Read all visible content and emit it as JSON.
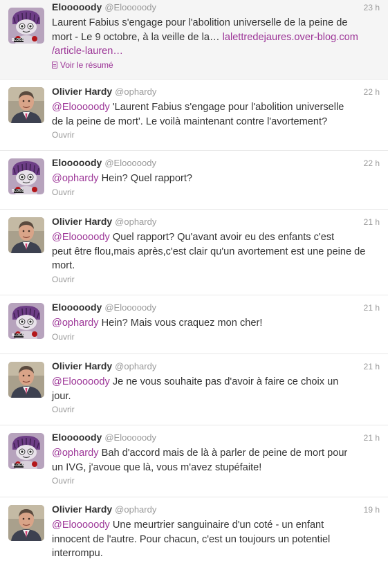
{
  "tweets": [
    {
      "name": "Elooooody",
      "handle": "@Elooooody",
      "time": "23 h",
      "avatar": "eloody",
      "line1": "Laurent Fabius s'engage pour l'abolition universelle de la peine de",
      "line2a": "mort - Le 9 octobre, à la veille de la… ",
      "link_a": "lalettredejaures.over-blog.com",
      "link_b": "/article-lauren…",
      "action": "Voir le résumé"
    },
    {
      "name": "Olivier Hardy",
      "handle": "@ophardy",
      "time": "22 h",
      "avatar": "hardy",
      "mention": "@Elooooody",
      "text_l1": " 'Laurent Fabius s'engage pour l'abolition universelle",
      "text_l2": "de la peine de mort'. Le voilà maintenant contre l'avortement?",
      "action": "Ouvrir"
    },
    {
      "name": "Elooooody",
      "handle": "@Elooooody",
      "time": "22 h",
      "avatar": "eloody",
      "mention": "@ophardy",
      "text_l1": " Hein? Quel rapport?",
      "action": "Ouvrir"
    },
    {
      "name": "Olivier Hardy",
      "handle": "@ophardy",
      "time": "21 h",
      "avatar": "hardy",
      "mention": "@Elooooody",
      "text_l1": " Quel rapport? Qu'avant avoir eu des enfants c'est",
      "text_l2": "peut être flou,mais après,c'est clair qu'un avortement est une peine de",
      "text_l3": "mort.",
      "action": "Ouvrir"
    },
    {
      "name": "Elooooody",
      "handle": "@Elooooody",
      "time": "21 h",
      "avatar": "eloody",
      "mention": "@ophardy",
      "text_l1": " Hein? Mais vous craquez mon cher!",
      "action": "Ouvrir"
    },
    {
      "name": "Olivier Hardy",
      "handle": "@ophardy",
      "time": "21 h",
      "avatar": "hardy",
      "mention": "@Elooooody",
      "text_l1": " Je ne vous souhaite pas d'avoir à faire ce choix un",
      "text_l2": "jour.",
      "action": "Ouvrir"
    },
    {
      "name": "Elooooody",
      "handle": "@Elooooody",
      "time": "21 h",
      "avatar": "eloody",
      "mention": "@ophardy",
      "text_l1": " Bah d'accord mais de là à parler de peine de mort pour",
      "text_l2": "un IVG, j'avoue que là, vous m'avez stupéfaite!",
      "action": "Ouvrir"
    },
    {
      "name": "Olivier Hardy",
      "handle": "@ophardy",
      "time": "19 h",
      "avatar": "hardy",
      "mention": "@Elooooody",
      "text_l1": " Une meurtrier sanguinaire d'un coté - un enfant",
      "text_l2": "innocent de l'autre. Pour chacun, c'est un toujours un potentiel",
      "text_l3": "interrompu."
    }
  ],
  "avatar_badge_text": "BLOGS",
  "colors": {
    "link": "#9b3396",
    "muted": "#999999",
    "text": "#333333"
  }
}
